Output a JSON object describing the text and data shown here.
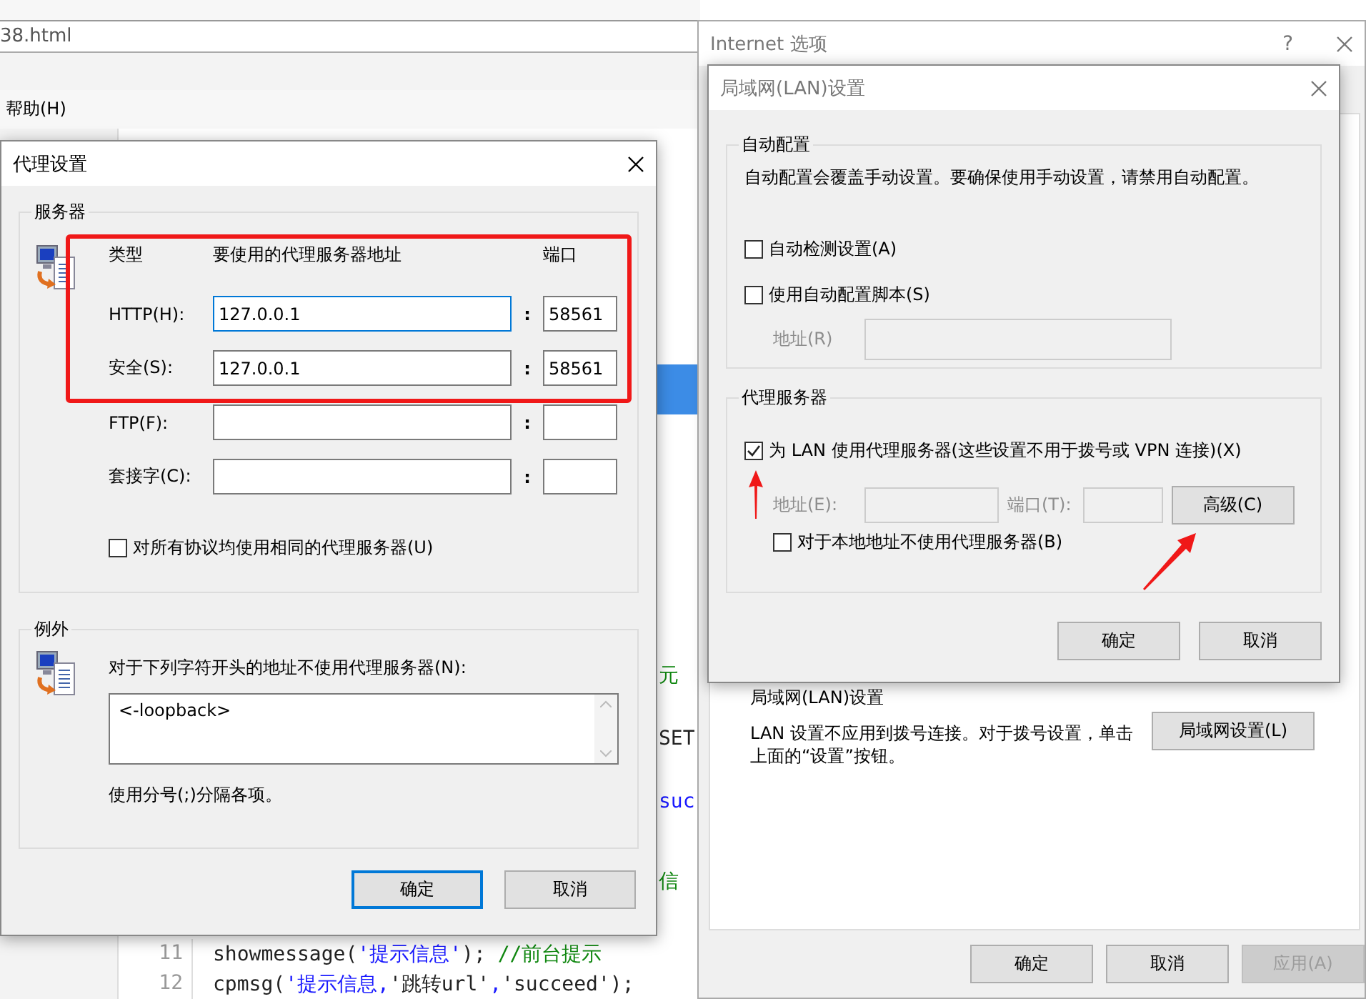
{
  "editor": {
    "file_tab": "38.html",
    "menu": [
      {
        "label": "帮助(H)"
      }
    ],
    "fragments": [
      {
        "text": "元",
        "kind": "comment"
      },
      {
        "text": "SET",
        "kind": "plain"
      },
      {
        "text": "suc",
        "kind": "keyword"
      },
      {
        "text": "信",
        "kind": "comment"
      }
    ],
    "lines": [
      {
        "number": "11",
        "segments": [
          {
            "text": "showmessage(",
            "kind": "plain"
          },
          {
            "text": "'提示信息'",
            "kind": "string"
          },
          {
            "text": "); ",
            "kind": "plain"
          },
          {
            "text": "//前台提示",
            "kind": "comment"
          }
        ]
      },
      {
        "number": "12",
        "segments": [
          {
            "text": "cpmsg(",
            "kind": "plain"
          },
          {
            "text": "'提示信息,",
            "kind": "string"
          },
          {
            "text": "'跳转url'",
            "kind": "plain"
          },
          {
            "text": ",",
            "kind": "string"
          },
          {
            "text": "'succeed'",
            "kind": "plain"
          },
          {
            "text": ");",
            "kind": "plain"
          }
        ]
      }
    ]
  },
  "proxy_dialog": {
    "title": "代理设置",
    "servers": {
      "legend": "服务器",
      "headers": [
        "类型",
        "要使用的代理服务器地址",
        "端口"
      ],
      "rows": [
        {
          "label": "HTTP(H):",
          "address": "127.0.0.1",
          "separator": ":",
          "port": "58561",
          "focused": true
        },
        {
          "label": "安全(S):",
          "address": "127.0.0.1",
          "separator": ":",
          "port": "58561",
          "focused": false
        },
        {
          "label": "FTP(F):",
          "separator": ":",
          "focused": false
        },
        {
          "label": "套接字(C):",
          "separator": ":",
          "focused": false
        }
      ],
      "same_proxy": {
        "label": "对所有协议均使用相同的代理服务器(U)",
        "checked": false
      }
    },
    "exceptions": {
      "legend": "例外",
      "prompt": "对于下列字符开头的地址不使用代理服务器(N):",
      "value": "<-loopback>",
      "hint": "使用分号(;)分隔各项。"
    },
    "buttons": [
      {
        "label": "确定",
        "default": true
      },
      {
        "label": "取消",
        "default": false
      }
    ]
  },
  "internet_options": {
    "title": "Internet 选项",
    "help": "?",
    "section_heading": "局域网(LAN)设置",
    "section_text": "LAN 设置不应用到拨号连接。对于拨号设置，单击上面的“设置”按钮。",
    "section_button": "局域网设置(L)",
    "buttons": [
      {
        "label": "确定",
        "disabled": false
      },
      {
        "label": "取消",
        "disabled": false
      },
      {
        "label": "应用(A)",
        "disabled": true
      }
    ]
  },
  "lan_dialog": {
    "title": "局域网(LAN)设置",
    "auto": {
      "legend": "自动配置",
      "text": "自动配置会覆盖手动设置。要确保使用手动设置，请禁用自动配置。",
      "checks": [
        {
          "label": "自动检测设置(A)",
          "checked": false
        },
        {
          "label": "使用自动配置脚本(S)",
          "checked": false
        }
      ],
      "address": {
        "label": "地址(R)",
        "disabled": true
      }
    },
    "proxy": {
      "legend": "代理服务器",
      "use_proxy": {
        "label": "为 LAN 使用代理服务器(这些设置不用于拨号或 VPN 连接)(X)",
        "checked": true
      },
      "address": {
        "label": "地址(E):",
        "disabled": true
      },
      "port": {
        "label": "端口(T):",
        "disabled": true
      },
      "advanced": "高级(C)",
      "bypass": {
        "label": "对于本地地址不使用代理服务器(B)",
        "checked": false
      }
    },
    "buttons": [
      {
        "label": "确定"
      },
      {
        "label": "取消"
      }
    ]
  }
}
